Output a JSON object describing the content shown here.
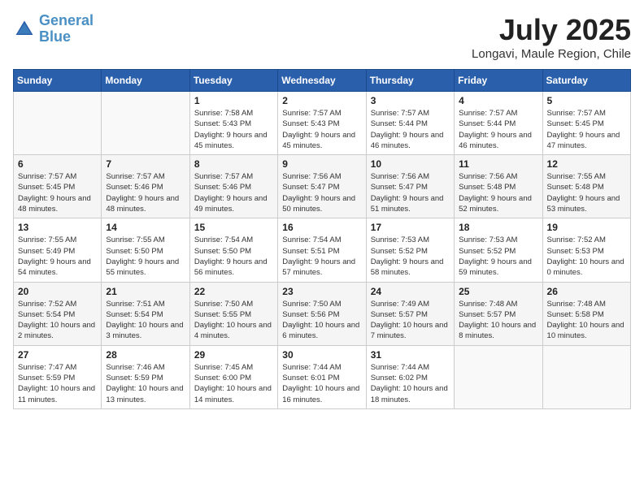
{
  "logo": {
    "line1": "General",
    "line2": "Blue"
  },
  "title": "July 2025",
  "location": "Longavi, Maule Region, Chile",
  "days_of_week": [
    "Sunday",
    "Monday",
    "Tuesday",
    "Wednesday",
    "Thursday",
    "Friday",
    "Saturday"
  ],
  "weeks": [
    [
      {
        "day": "",
        "info": ""
      },
      {
        "day": "",
        "info": ""
      },
      {
        "day": "1",
        "info": "Sunrise: 7:58 AM\nSunset: 5:43 PM\nDaylight: 9 hours and 45 minutes."
      },
      {
        "day": "2",
        "info": "Sunrise: 7:57 AM\nSunset: 5:43 PM\nDaylight: 9 hours and 45 minutes."
      },
      {
        "day": "3",
        "info": "Sunrise: 7:57 AM\nSunset: 5:44 PM\nDaylight: 9 hours and 46 minutes."
      },
      {
        "day": "4",
        "info": "Sunrise: 7:57 AM\nSunset: 5:44 PM\nDaylight: 9 hours and 46 minutes."
      },
      {
        "day": "5",
        "info": "Sunrise: 7:57 AM\nSunset: 5:45 PM\nDaylight: 9 hours and 47 minutes."
      }
    ],
    [
      {
        "day": "6",
        "info": "Sunrise: 7:57 AM\nSunset: 5:45 PM\nDaylight: 9 hours and 48 minutes."
      },
      {
        "day": "7",
        "info": "Sunrise: 7:57 AM\nSunset: 5:46 PM\nDaylight: 9 hours and 48 minutes."
      },
      {
        "day": "8",
        "info": "Sunrise: 7:57 AM\nSunset: 5:46 PM\nDaylight: 9 hours and 49 minutes."
      },
      {
        "day": "9",
        "info": "Sunrise: 7:56 AM\nSunset: 5:47 PM\nDaylight: 9 hours and 50 minutes."
      },
      {
        "day": "10",
        "info": "Sunrise: 7:56 AM\nSunset: 5:47 PM\nDaylight: 9 hours and 51 minutes."
      },
      {
        "day": "11",
        "info": "Sunrise: 7:56 AM\nSunset: 5:48 PM\nDaylight: 9 hours and 52 minutes."
      },
      {
        "day": "12",
        "info": "Sunrise: 7:55 AM\nSunset: 5:48 PM\nDaylight: 9 hours and 53 minutes."
      }
    ],
    [
      {
        "day": "13",
        "info": "Sunrise: 7:55 AM\nSunset: 5:49 PM\nDaylight: 9 hours and 54 minutes."
      },
      {
        "day": "14",
        "info": "Sunrise: 7:55 AM\nSunset: 5:50 PM\nDaylight: 9 hours and 55 minutes."
      },
      {
        "day": "15",
        "info": "Sunrise: 7:54 AM\nSunset: 5:50 PM\nDaylight: 9 hours and 56 minutes."
      },
      {
        "day": "16",
        "info": "Sunrise: 7:54 AM\nSunset: 5:51 PM\nDaylight: 9 hours and 57 minutes."
      },
      {
        "day": "17",
        "info": "Sunrise: 7:53 AM\nSunset: 5:52 PM\nDaylight: 9 hours and 58 minutes."
      },
      {
        "day": "18",
        "info": "Sunrise: 7:53 AM\nSunset: 5:52 PM\nDaylight: 9 hours and 59 minutes."
      },
      {
        "day": "19",
        "info": "Sunrise: 7:52 AM\nSunset: 5:53 PM\nDaylight: 10 hours and 0 minutes."
      }
    ],
    [
      {
        "day": "20",
        "info": "Sunrise: 7:52 AM\nSunset: 5:54 PM\nDaylight: 10 hours and 2 minutes."
      },
      {
        "day": "21",
        "info": "Sunrise: 7:51 AM\nSunset: 5:54 PM\nDaylight: 10 hours and 3 minutes."
      },
      {
        "day": "22",
        "info": "Sunrise: 7:50 AM\nSunset: 5:55 PM\nDaylight: 10 hours and 4 minutes."
      },
      {
        "day": "23",
        "info": "Sunrise: 7:50 AM\nSunset: 5:56 PM\nDaylight: 10 hours and 6 minutes."
      },
      {
        "day": "24",
        "info": "Sunrise: 7:49 AM\nSunset: 5:57 PM\nDaylight: 10 hours and 7 minutes."
      },
      {
        "day": "25",
        "info": "Sunrise: 7:48 AM\nSunset: 5:57 PM\nDaylight: 10 hours and 8 minutes."
      },
      {
        "day": "26",
        "info": "Sunrise: 7:48 AM\nSunset: 5:58 PM\nDaylight: 10 hours and 10 minutes."
      }
    ],
    [
      {
        "day": "27",
        "info": "Sunrise: 7:47 AM\nSunset: 5:59 PM\nDaylight: 10 hours and 11 minutes."
      },
      {
        "day": "28",
        "info": "Sunrise: 7:46 AM\nSunset: 5:59 PM\nDaylight: 10 hours and 13 minutes."
      },
      {
        "day": "29",
        "info": "Sunrise: 7:45 AM\nSunset: 6:00 PM\nDaylight: 10 hours and 14 minutes."
      },
      {
        "day": "30",
        "info": "Sunrise: 7:44 AM\nSunset: 6:01 PM\nDaylight: 10 hours and 16 minutes."
      },
      {
        "day": "31",
        "info": "Sunrise: 7:44 AM\nSunset: 6:02 PM\nDaylight: 10 hours and 18 minutes."
      },
      {
        "day": "",
        "info": ""
      },
      {
        "day": "",
        "info": ""
      }
    ]
  ]
}
